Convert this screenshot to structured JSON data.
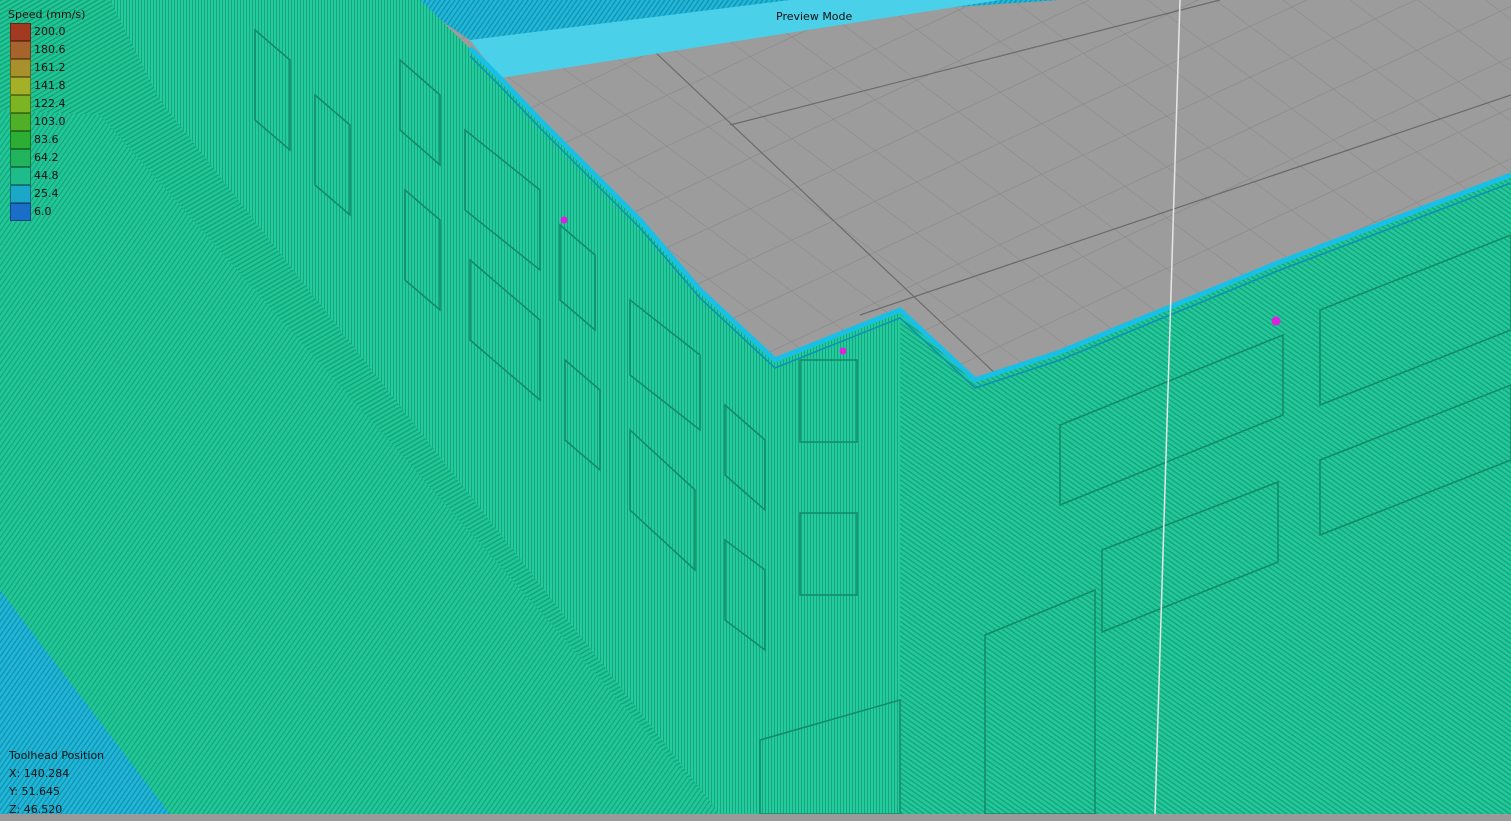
{
  "mode_label": "Preview Mode",
  "legend": {
    "title": "Speed (mm/s)",
    "items": [
      {
        "label": "200.0",
        "color": "#a23a22"
      },
      {
        "label": "180.6",
        "color": "#a6632c"
      },
      {
        "label": "161.2",
        "color": "#a8912c"
      },
      {
        "label": "141.8",
        "color": "#a4b028"
      },
      {
        "label": "122.4",
        "color": "#7cb424"
      },
      {
        "label": "103.0",
        "color": "#4fb028"
      },
      {
        "label": "83.6",
        "color": "#2cae34"
      },
      {
        "label": "64.2",
        "color": "#22b45c"
      },
      {
        "label": "44.8",
        "color": "#1ebc8a"
      },
      {
        "label": "25.4",
        "color": "#1ba8c8"
      },
      {
        "label": "6.0",
        "color": "#1a6ec8"
      }
    ]
  },
  "toolhead": {
    "title": "Toolhead Position",
    "x": "X: 140.284",
    "y": "Y: 51.645",
    "z": "Z: 46.520"
  },
  "colors": {
    "bed": "#9a9a9a",
    "grid_minor": "#888888",
    "grid_major": "#6e6e6e",
    "wall": "#20c896",
    "wall_stripe": "#18a87c",
    "outline": "#18c0e8",
    "marker": "#e020e0"
  }
}
